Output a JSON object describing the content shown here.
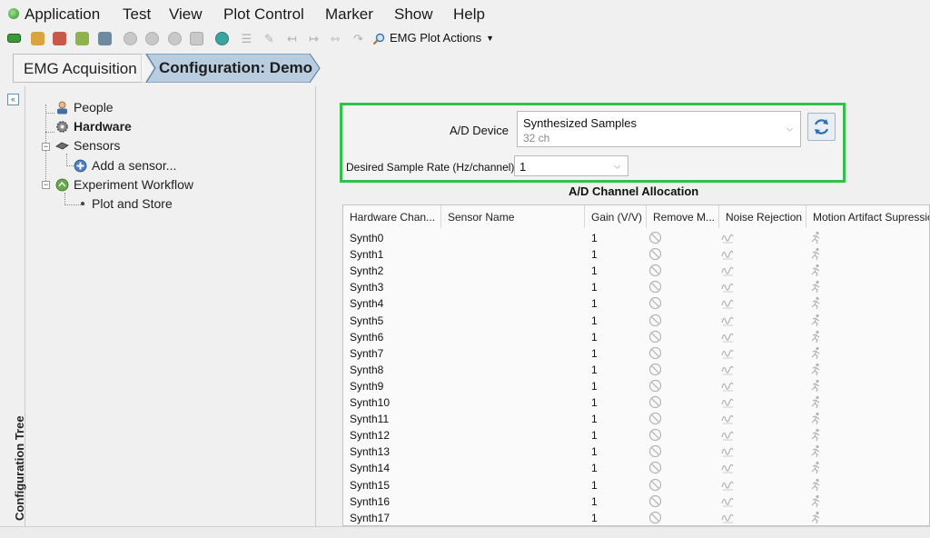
{
  "menu": {
    "items": [
      "Application",
      "Test",
      "View",
      "Plot Control",
      "Marker",
      "Show",
      "Help"
    ]
  },
  "toolbar": {
    "actions_label": "EMG Plot Actions"
  },
  "breadcrumb": {
    "items": [
      "EMG Acquisition",
      "Configuration: Demo"
    ]
  },
  "left_panel": {
    "title": "Configuration Tree",
    "tree": [
      {
        "label": "People",
        "icon": "person-icon",
        "bold": false
      },
      {
        "label": "Hardware",
        "icon": "gear-icon",
        "bold": true
      },
      {
        "label": "Sensors",
        "icon": "sensor-icon",
        "bold": false
      },
      {
        "label": "Add a sensor...",
        "icon": "add-circle-icon",
        "bold": false
      },
      {
        "label": "Experiment Workflow",
        "icon": "workflow-icon",
        "bold": false
      },
      {
        "label": "Plot and Store",
        "icon": "dot-icon",
        "bold": false
      }
    ]
  },
  "device": {
    "label": "A/D Device",
    "selected": "Synthesized Samples",
    "selected_sub": "32 ch",
    "rate_label": "Desired Sample Rate (Hz/channel)",
    "rate_value": "1",
    "highlight_color": "#2ec24a"
  },
  "allocation": {
    "title": "A/D Channel Allocation",
    "columns": [
      "Hardware Chan...",
      "Sensor Name",
      "Gain (V/V)",
      "Remove M...",
      "Noise Rejection",
      "Motion Artifact Supressic"
    ],
    "rows": [
      {
        "channel": "Synth0",
        "sensor": "",
        "gain": "1"
      },
      {
        "channel": "Synth1",
        "sensor": "",
        "gain": "1"
      },
      {
        "channel": "Synth2",
        "sensor": "",
        "gain": "1"
      },
      {
        "channel": "Synth3",
        "sensor": "",
        "gain": "1"
      },
      {
        "channel": "Synth4",
        "sensor": "",
        "gain": "1"
      },
      {
        "channel": "Synth5",
        "sensor": "",
        "gain": "1"
      },
      {
        "channel": "Synth6",
        "sensor": "",
        "gain": "1"
      },
      {
        "channel": "Synth7",
        "sensor": "",
        "gain": "1"
      },
      {
        "channel": "Synth8",
        "sensor": "",
        "gain": "1"
      },
      {
        "channel": "Synth9",
        "sensor": "",
        "gain": "1"
      },
      {
        "channel": "Synth10",
        "sensor": "",
        "gain": "1"
      },
      {
        "channel": "Synth11",
        "sensor": "",
        "gain": "1"
      },
      {
        "channel": "Synth12",
        "sensor": "",
        "gain": "1"
      },
      {
        "channel": "Synth13",
        "sensor": "",
        "gain": "1"
      },
      {
        "channel": "Synth14",
        "sensor": "",
        "gain": "1"
      },
      {
        "channel": "Synth15",
        "sensor": "",
        "gain": "1"
      },
      {
        "channel": "Synth16",
        "sensor": "",
        "gain": "1"
      },
      {
        "channel": "Synth17",
        "sensor": "",
        "gain": "1"
      }
    ]
  }
}
